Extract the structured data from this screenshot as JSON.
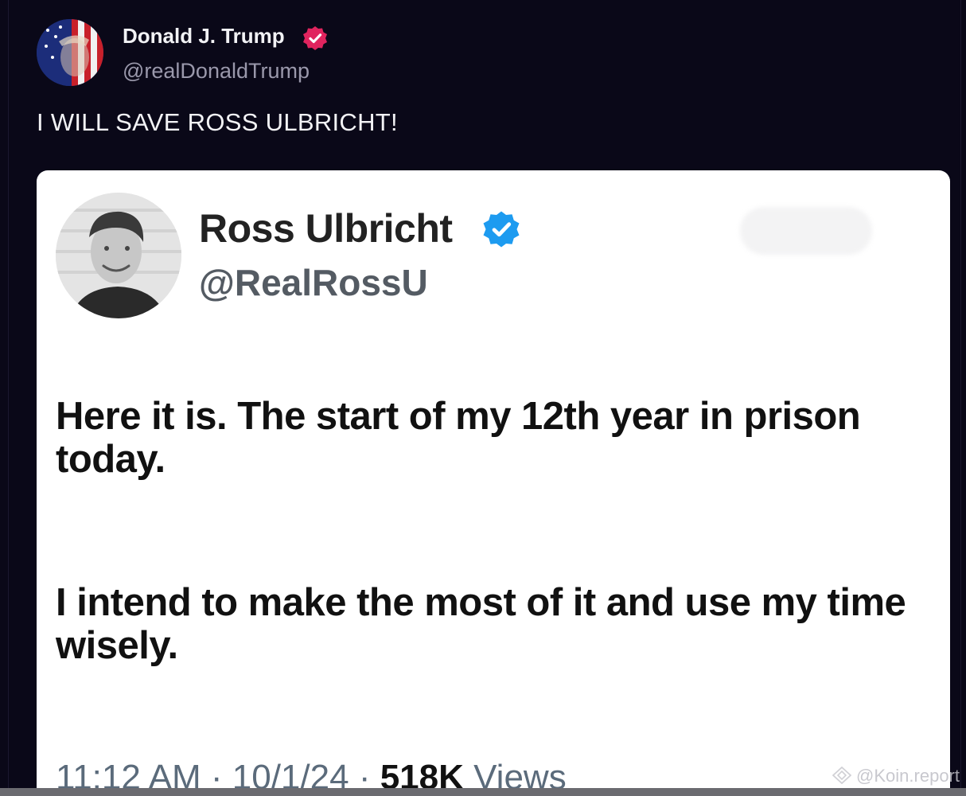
{
  "post": {
    "author_name": "Donald J. Trump",
    "author_handle": "@realDonaldTrump",
    "text": "I WILL SAVE ROSS ULBRICHT!",
    "verified_badge_color": "#e0245e"
  },
  "embedded_tweet": {
    "author_name": "Ross Ulbricht",
    "author_handle": "@RealRossU",
    "verified_badge_color": "#1d9bf0",
    "paragraph_1": "Here it is. The start of my 12th year in prison today.",
    "paragraph_2": "I intend to make the most of it and use my time wisely.",
    "time": "11:12 AM",
    "date": "10/1/24",
    "views_count": "518K",
    "views_label": "Views",
    "separator": "·"
  },
  "watermark": {
    "text": "@Koin.report"
  },
  "colors": {
    "background": "#0a0818",
    "card": "#ffffff",
    "handle_gray": "#9a98ab"
  }
}
